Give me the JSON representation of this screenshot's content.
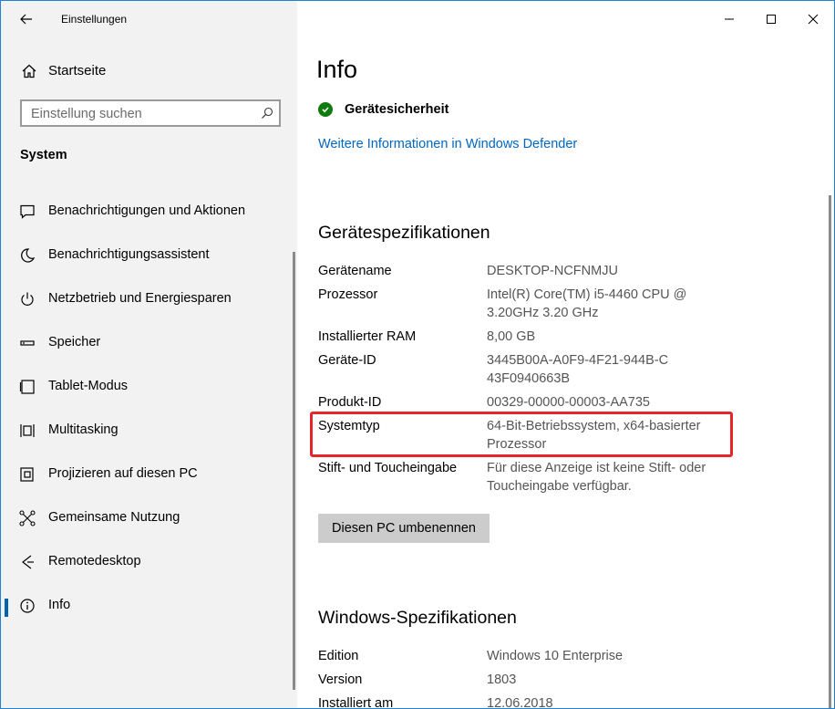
{
  "window": {
    "app_title": "Einstellungen"
  },
  "sidebar": {
    "home_label": "Startseite",
    "search_placeholder": "Einstellung suchen",
    "group_title": "System",
    "items": [
      {
        "label": "Benachrichtigungen und Aktionen",
        "icon": "notification-icon"
      },
      {
        "label": "Benachrichtigungsassistent",
        "icon": "moon-icon"
      },
      {
        "label": "Netzbetrieb und Energiesparen",
        "icon": "power-icon"
      },
      {
        "label": "Speicher",
        "icon": "storage-icon"
      },
      {
        "label": "Tablet-Modus",
        "icon": "tablet-icon"
      },
      {
        "label": "Multitasking",
        "icon": "multitasking-icon"
      },
      {
        "label": "Projizieren auf diesen PC",
        "icon": "project-icon"
      },
      {
        "label": "Gemeinsame Nutzung",
        "icon": "share-icon"
      },
      {
        "label": "Remotedesktop",
        "icon": "remote-icon"
      },
      {
        "label": "Info",
        "icon": "info-icon",
        "active": true
      }
    ]
  },
  "main": {
    "title": "Info",
    "security_label": "Gerätesicherheit",
    "defender_link": "Weitere Informationen in Windows Defender",
    "device_specs_title": "Gerätespezifikationen",
    "device_specs": [
      {
        "label": "Gerätename",
        "value": "DESKTOP-NCFNMJU"
      },
      {
        "label": "Prozessor",
        "value": "Intel(R) Core(TM) i5-4460  CPU @ 3.20GHz   3.20 GHz"
      },
      {
        "label": "Installierter RAM",
        "value": "8,00 GB"
      },
      {
        "label": "Geräte-ID",
        "value": "3445B00A-A0F9-4F21-944B-C43F0940663B"
      },
      {
        "label": "Produkt-ID",
        "value": "00329-00000-00003-AA735"
      },
      {
        "label": "Systemtyp",
        "value": "64-Bit-Betriebssystem, x64-basierter Prozessor"
      },
      {
        "label": "Stift- und Toucheingabe",
        "value": "Für diese Anzeige ist keine Stift- oder Toucheingabe verfügbar."
      }
    ],
    "rename_button": "Diesen PC umbenennen",
    "windows_specs_title": "Windows-Spezifikationen",
    "windows_specs": [
      {
        "label": "Edition",
        "value": "Windows 10 Enterprise"
      },
      {
        "label": "Version",
        "value": "1803"
      },
      {
        "label": "Installiert am",
        "value": "12.06.2018"
      }
    ]
  }
}
